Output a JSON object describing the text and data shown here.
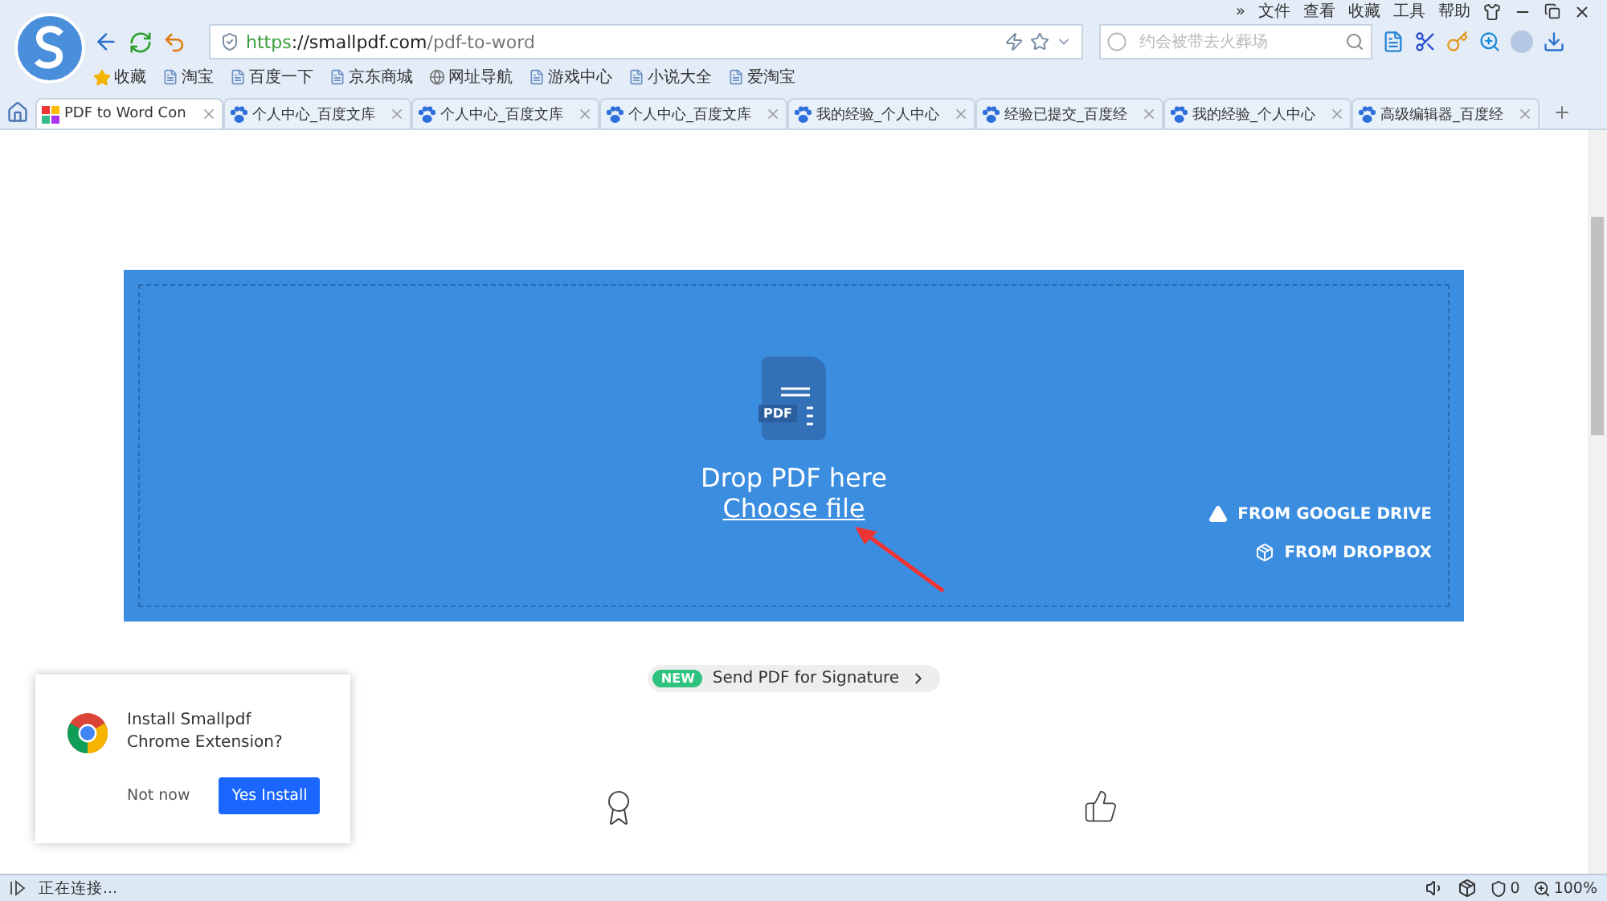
{
  "menu": [
    {
      "label": "»"
    },
    {
      "label": "文件"
    },
    {
      "label": "查看"
    },
    {
      "label": "收藏"
    },
    {
      "label": "工具"
    },
    {
      "label": "帮助"
    }
  ],
  "address": {
    "scheme": "https",
    "rest": "://smallpdf.com",
    "path": "/pdf-to-word"
  },
  "search": {
    "placeholder": "约会被带去火葬场"
  },
  "bookmarks": [
    {
      "label": "收藏",
      "kind": "star"
    },
    {
      "label": "淘宝",
      "kind": "page"
    },
    {
      "label": "百度一下",
      "kind": "page"
    },
    {
      "label": "京东商城",
      "kind": "page"
    },
    {
      "label": "网址导航",
      "kind": "globe"
    },
    {
      "label": "游戏中心",
      "kind": "page"
    },
    {
      "label": "小说大全",
      "kind": "page"
    },
    {
      "label": "爱淘宝",
      "kind": "page"
    }
  ],
  "tabs": [
    {
      "label": "PDF to Word Con",
      "selected": true,
      "kind": "pdf"
    },
    {
      "label": "个人中心_百度文库",
      "selected": false,
      "kind": "paw"
    },
    {
      "label": "个人中心_百度文库",
      "selected": false,
      "kind": "paw"
    },
    {
      "label": "个人中心_百度文库",
      "selected": false,
      "kind": "paw"
    },
    {
      "label": "我的经验_个人中心",
      "selected": false,
      "kind": "paw"
    },
    {
      "label": "经验已提交_百度经",
      "selected": false,
      "kind": "paw"
    },
    {
      "label": "我的经验_个人中心",
      "selected": false,
      "kind": "paw"
    },
    {
      "label": "高级编辑器_百度经",
      "selected": false,
      "kind": "paw"
    }
  ],
  "dropzone": {
    "icon_label": "PDF",
    "title": "Drop PDF here",
    "link": "Choose file",
    "sources": [
      {
        "label": "FROM GOOGLE DRIVE",
        "kind": "drive"
      },
      {
        "label": "FROM DROPBOX",
        "kind": "dropbox"
      }
    ]
  },
  "promo": {
    "badge": "NEW",
    "label": "Send PDF for Signature"
  },
  "popup": {
    "message": "Install Smallpdf Chrome Extension?",
    "dismiss": "Not now",
    "confirm": "Yes Install"
  },
  "status_bar": {
    "text": "正在连接...",
    "blocked": "0",
    "zoom": "100%"
  }
}
